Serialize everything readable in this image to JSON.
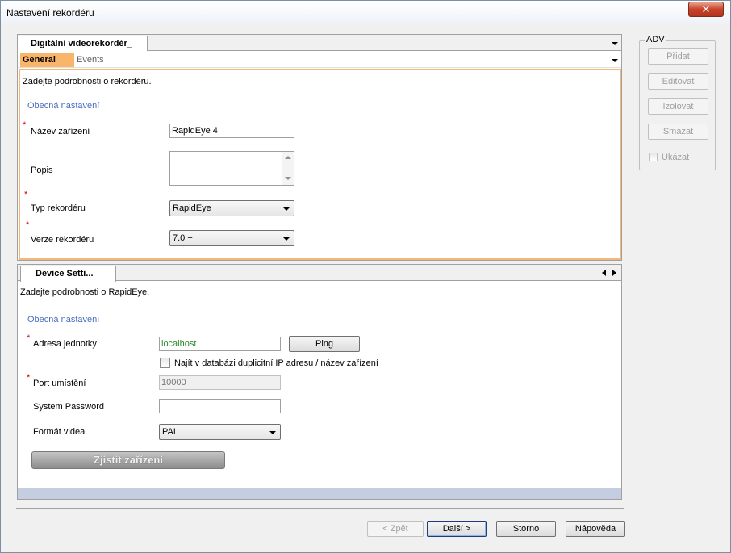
{
  "window": {
    "title": "Nastavení rekordéru",
    "close_glyph": "✕"
  },
  "doc_tab": {
    "label": "Digitální videorekordér_"
  },
  "sub_tabs": [
    {
      "label": "General",
      "active": true
    },
    {
      "label": "Events",
      "active": false
    }
  ],
  "general": {
    "intro": "Zadejte podrobnosti o rekordéru.",
    "section_heading": "Obecná nastavení",
    "device_name": {
      "label": "Název zařízení",
      "value": "RapidEye 4",
      "required": "*"
    },
    "description": {
      "label": "Popis",
      "value": ""
    },
    "recorder_type": {
      "label": "Typ rekordéru",
      "value": "RapidEye",
      "required": "*"
    },
    "recorder_version": {
      "label": "Verze rekordéru",
      "value": "7.0 +",
      "required": "*"
    }
  },
  "device_settings": {
    "tab_label": "Device Setti...",
    "intro": "Zadejte podrobnosti o RapidEye.",
    "section_heading": "Obecná nastavení",
    "unit_address": {
      "label": "Adresa jednotky",
      "value": "localhost",
      "required": "*"
    },
    "ping_label": "Ping",
    "duplicate_check_label": "Najít v databázi duplicitní IP adresu / název zařízení",
    "port": {
      "label": "Port umístění",
      "value": "10000",
      "required": "*"
    },
    "system_password": {
      "label": "System Password",
      "value": ""
    },
    "video_format": {
      "label": "Formát videa",
      "value": "PAL"
    },
    "detect_label": "Zjistit zařízení"
  },
  "adv": {
    "title": "ADV",
    "add_label": "Přidat",
    "edit_label": "Editovat",
    "isolate_label": "Izolovat",
    "delete_label": "Smazat",
    "show_label": "Ukázat"
  },
  "footer": {
    "back_label": "< Zpět",
    "next_label": "Další >",
    "cancel_label": "Storno",
    "help_label": "Nápověda"
  },
  "colors": {
    "active_tab": "#f9b56a",
    "general_border": "#f6b879",
    "section_heading": "#4a6ec0",
    "required_marker": "#d00000",
    "address_text": "#2a8a2a"
  }
}
